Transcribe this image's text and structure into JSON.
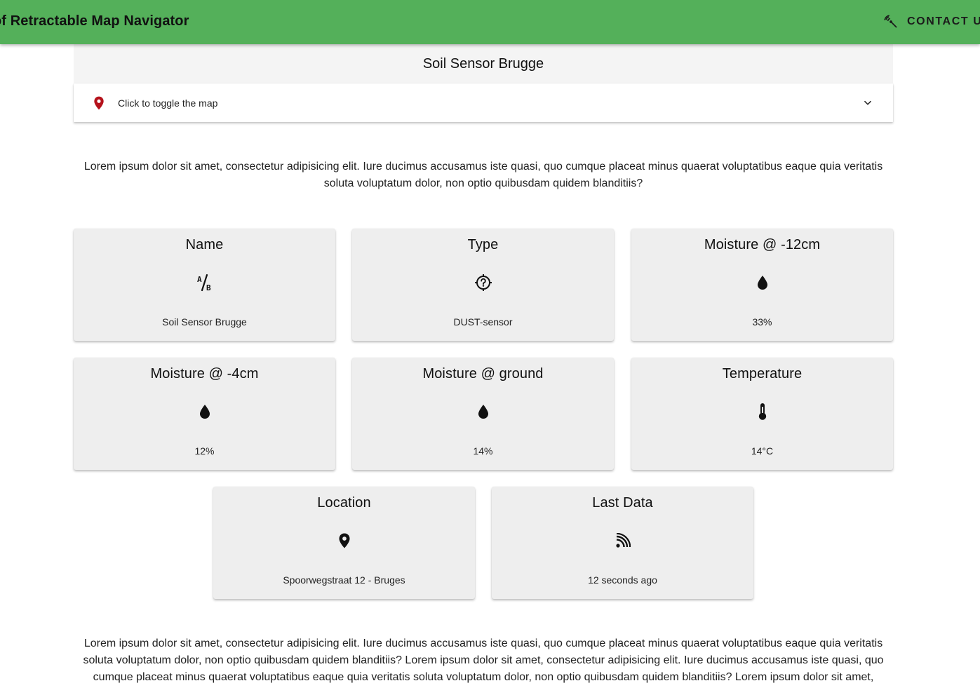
{
  "topbar": {
    "title": "o of Retractable Map Navigator",
    "contact_label": "CONTACT US",
    "contact_icon": "network-sensor-icon",
    "bg_color": "#54b05a"
  },
  "header": {
    "title": "Soil Sensor Brugge"
  },
  "map_toggle": {
    "label": "Click to toggle the map",
    "pin_icon": "map-pin-icon",
    "pin_color": "#b5121b",
    "expand_icon": "chevron-down-icon"
  },
  "intro_text": "Lorem ipsum dolor sit amet, consectetur adipisicing elit. Iure ducimus accusamus iste quasi, quo cumque placeat minus quaerat voluptatibus eaque quia veritatis soluta voluptatum dolor, non optio quibusdam quidem blanditiis?",
  "cards": [
    {
      "title": "Name",
      "icon": "format-text-icon",
      "value": "Soil Sensor Brugge"
    },
    {
      "title": "Type",
      "icon": "help-crosshair-icon",
      "value": "DUST-sensor"
    },
    {
      "title": "Moisture @ -12cm",
      "icon": "water-drop-icon",
      "value": "33%"
    },
    {
      "title": "Moisture @ -4cm",
      "icon": "water-drop-icon",
      "value": "12%"
    },
    {
      "title": "Moisture @ ground",
      "icon": "water-drop-icon",
      "value": "14%"
    },
    {
      "title": "Temperature",
      "icon": "thermometer-icon",
      "value": "14°C"
    },
    {
      "title": "Location",
      "icon": "map-pin-icon",
      "value": "Spoorwegstraat 12 - Bruges"
    },
    {
      "title": "Last Data",
      "icon": "rss-feed-icon",
      "value": "12 seconds ago"
    }
  ],
  "footer_text": "Lorem ipsum dolor sit amet, consectetur adipisicing elit. Iure ducimus accusamus iste quasi, quo cumque placeat minus quaerat voluptatibus eaque quia veritatis soluta voluptatum dolor, non optio quibusdam quidem blanditiis? Lorem ipsum dolor sit amet, consectetur adipisicing elit. Iure ducimus accusamus iste quasi, quo cumque placeat minus quaerat voluptatibus eaque quia veritatis soluta voluptatum dolor, non optio quibusdam quidem blanditiis? Lorem ipsum dolor sit amet,"
}
